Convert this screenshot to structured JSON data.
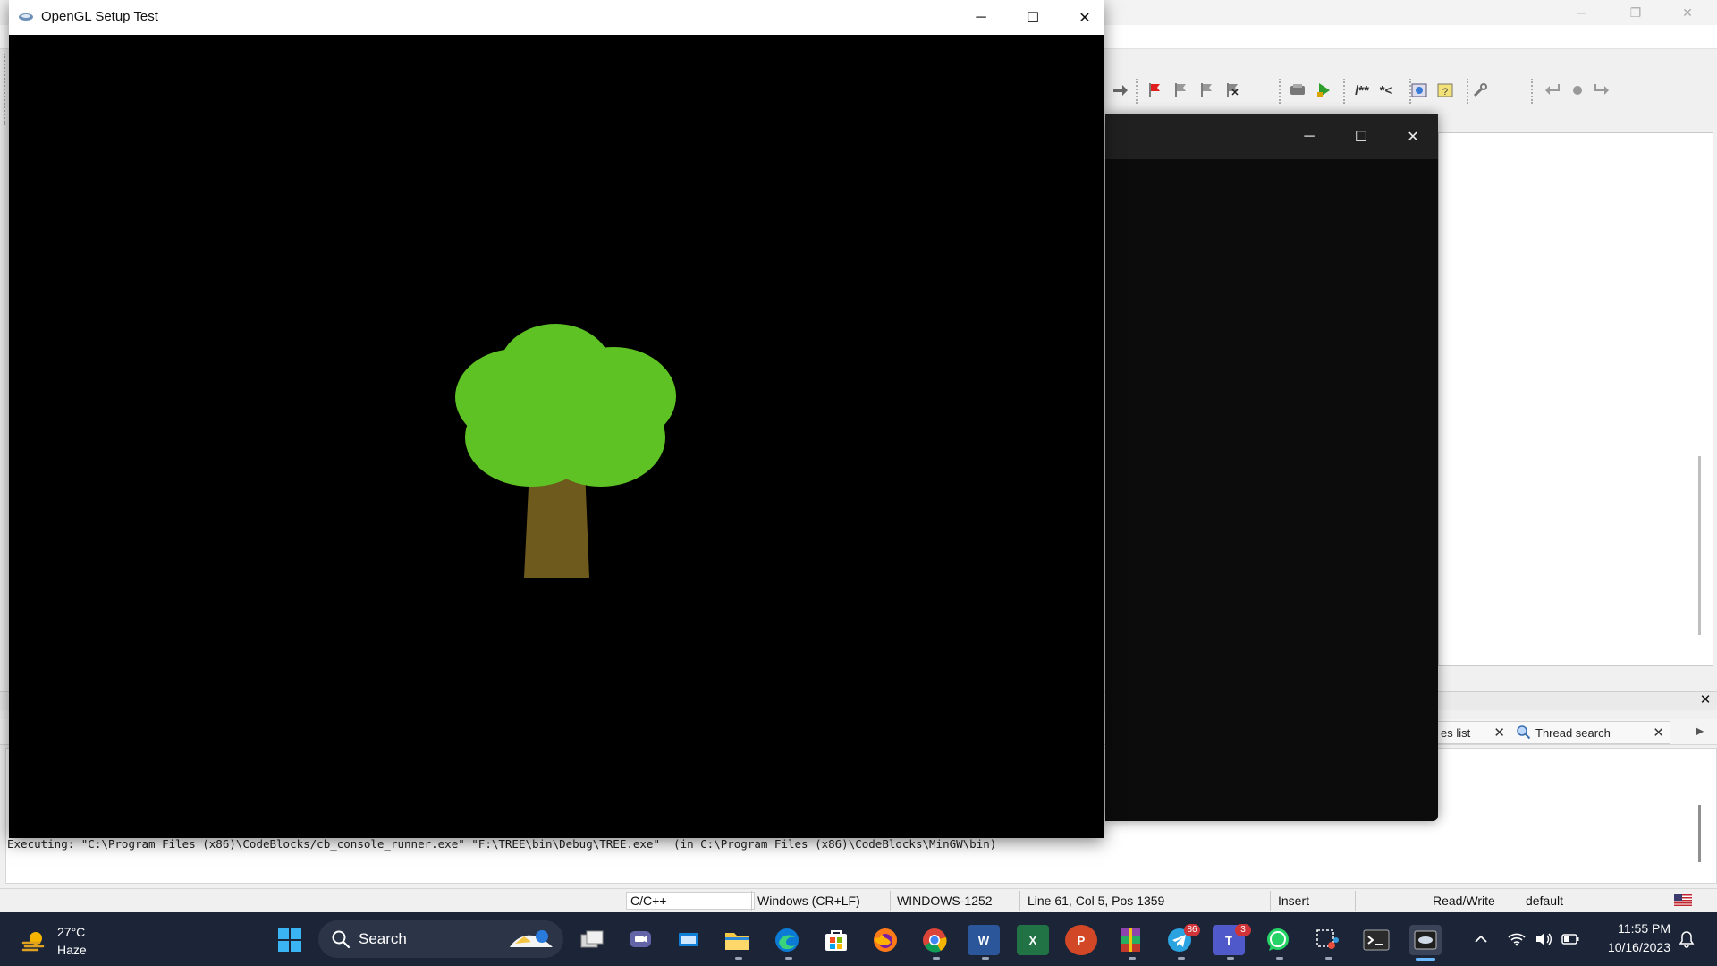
{
  "gl_window": {
    "title": "OpenGL Setup Test",
    "minimize_glyph": "─",
    "maximize_glyph": "☐",
    "close_glyph": "✕",
    "tree": {
      "foliage_color": "#5ec224",
      "trunk_color": "#6e5a1d"
    }
  },
  "console_window": {
    "minimize_glyph": "─",
    "maximize_glyph": "☐",
    "close_glyph": "✕"
  },
  "ide": {
    "window_controls": {
      "minimize": "─",
      "restore": "❐",
      "close": "✕"
    },
    "log_tabs": [
      {
        "label": "es list"
      },
      {
        "label": "Thread search"
      }
    ],
    "logs_close_glyph": "✕",
    "exec_line": "Executing: \"C:\\Program Files (x86)\\CodeBlocks/cb_console_runner.exe\" \"F:\\TREE\\bin\\Debug\\TREE.exe\"  (in C:\\Program Files (x86)\\CodeBlocks\\MinGW\\bin)",
    "status_bar": {
      "language": "C/C++",
      "line_endings": "Windows (CR+LF)",
      "encoding": "WINDOWS-1252",
      "position": "Line 61, Col 5, Pos 1359",
      "mode": "Insert",
      "access": "Read/Write",
      "profile": "default"
    },
    "toolbar_icons": [
      "arrow-right-icon",
      "flag-icon",
      "bookmark-prev-icon",
      "bookmark-next-icon",
      "bookmark-clear-icon",
      "build-icon",
      "run-icon",
      "doxygen-comment-icon",
      "doxygen-inline-icon",
      "html-doc-icon",
      "help-doc-icon",
      "settings-wrench-icon",
      "nav-back-icon",
      "nav-dot-icon",
      "nav-forward-icon"
    ],
    "toolbar_labels": {
      "doxy_block": "/**",
      "doxy_line": "*<"
    }
  },
  "taskbar": {
    "weather": {
      "temp": "27°C",
      "desc": "Haze"
    },
    "search_label": "Search",
    "apps": [
      {
        "name": "windows-start-icon"
      },
      {
        "name": "task-view-icon"
      },
      {
        "name": "teams-chat-icon"
      },
      {
        "name": "remote-desktop-icon"
      },
      {
        "name": "file-explorer-icon"
      },
      {
        "name": "edge-browser-icon"
      },
      {
        "name": "microsoft-store-icon"
      },
      {
        "name": "firefox-icon"
      },
      {
        "name": "chrome-icon"
      },
      {
        "name": "word-icon",
        "letter": "W"
      },
      {
        "name": "excel-icon",
        "letter": "X"
      },
      {
        "name": "powerpoint-icon",
        "letter": "P"
      },
      {
        "name": "winrar-icon"
      },
      {
        "name": "telegram-icon",
        "badge": "86"
      },
      {
        "name": "teams-icon",
        "badge": "3",
        "letter": "T"
      },
      {
        "name": "whatsapp-icon"
      },
      {
        "name": "snipping-tool-icon"
      },
      {
        "name": "terminal-icon"
      },
      {
        "name": "codeblocks-icon"
      }
    ],
    "tray": {
      "time": "11:55 PM",
      "date": "10/16/2023"
    }
  }
}
